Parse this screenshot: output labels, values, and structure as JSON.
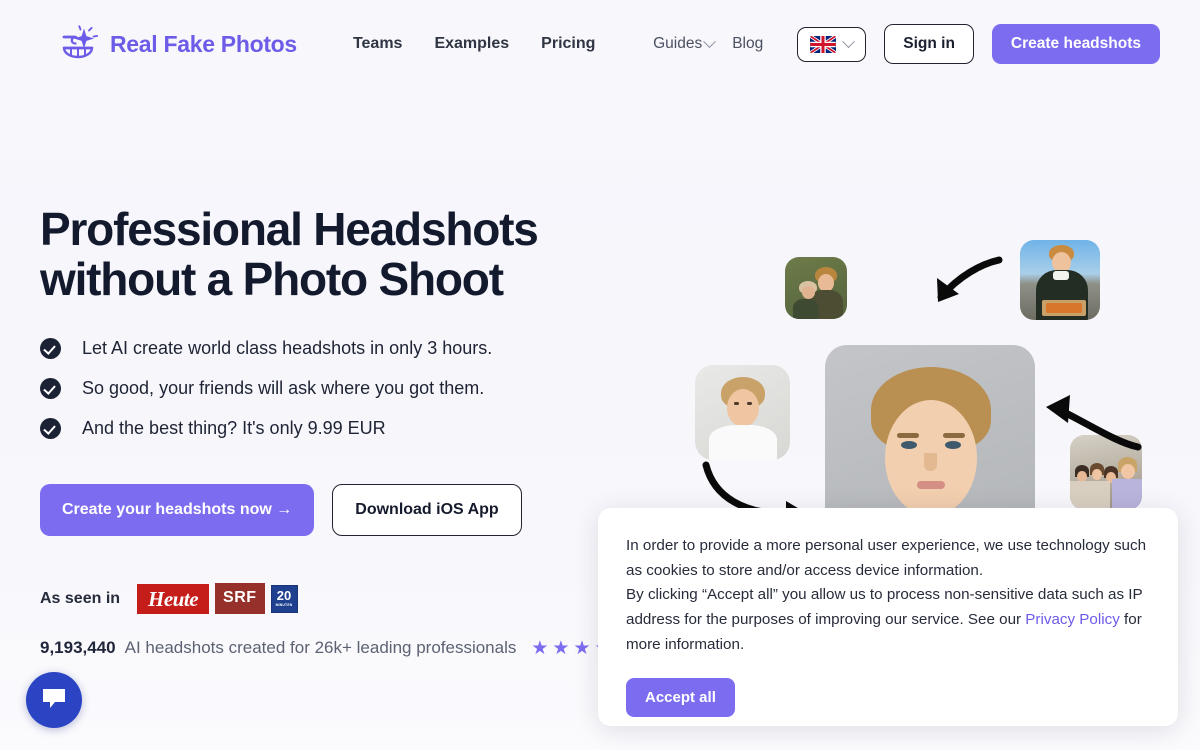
{
  "brand": {
    "name": "Real Fake Photos",
    "mark_icon": "sparkle-smile-logo",
    "color": "#6c5ce7"
  },
  "nav": {
    "primary": [
      {
        "label": "Teams",
        "name": "nav-link-teams"
      },
      {
        "label": "Examples",
        "name": "nav-link-examples"
      },
      {
        "label": "Pricing",
        "name": "nav-link-pricing"
      }
    ],
    "secondary": [
      {
        "label": "Guides",
        "has_chevron": true
      },
      {
        "label": "Blog",
        "has_chevron": false
      }
    ],
    "language": {
      "flag": "uk-flag-icon",
      "chevron": "chevron-down-icon"
    },
    "sign_in": "Sign in",
    "create_headshots": "Create headshots"
  },
  "hero": {
    "title_line1": "Professional Headshots",
    "title_line2": "without a Photo Shoot",
    "bullets": [
      "Let AI create world class headshots in only 3 hours.",
      "So good, your friends will ask where you got them.",
      "And the best thing? It's only 9.99 EUR"
    ],
    "cta_primary": "Create your headshots now →",
    "cta_secondary": "Download iOS App",
    "seen_in_label": "As seen in",
    "press": [
      {
        "name": "Heute",
        "label": "Heute",
        "color": "#c41d1a"
      },
      {
        "name": "SRF",
        "label": "SRF",
        "color": "#96302a"
      },
      {
        "name": "20 Minuten",
        "label": "20",
        "sub": "MINUTEN",
        "color": "#1f3f8f"
      }
    ],
    "stats_number": "9,193,440",
    "stats_text": "AI headshots created for 26k+ leading professionals",
    "stars": 5,
    "star_color": "#7c6cf0"
  },
  "collage": {
    "photos": [
      {
        "name": "photo-couple-outdoor",
        "alt": "Two people outdoors in front of green hedge"
      },
      {
        "name": "photo-rooftop-pizza",
        "alt": "Man in dark sweater on rooftop holding pizza box"
      },
      {
        "name": "photo-selfie-white-shirt",
        "alt": "Man in white t-shirt against plain wall"
      },
      {
        "name": "photo-group-friends",
        "alt": "Group of friends smiling indoors"
      },
      {
        "name": "photo-main-headshot",
        "alt": "Professional headshot of man in suit and tie on grey background"
      }
    ],
    "arrows": 3
  },
  "cookie": {
    "paragraph1": "In order to provide a more personal user experience, we use technology such as cookies to store and/or access device information.",
    "paragraph2_pre": "By clicking “Accept all” you allow us to process non-sensitive data such as IP address for the purposes of improving our service. See our ",
    "link": "Privacy Policy",
    "paragraph2_post": " for more information.",
    "accept_label": "Accept all"
  },
  "chat": {
    "icon": "chat-bubble-icon",
    "color": "#2b44c4"
  }
}
